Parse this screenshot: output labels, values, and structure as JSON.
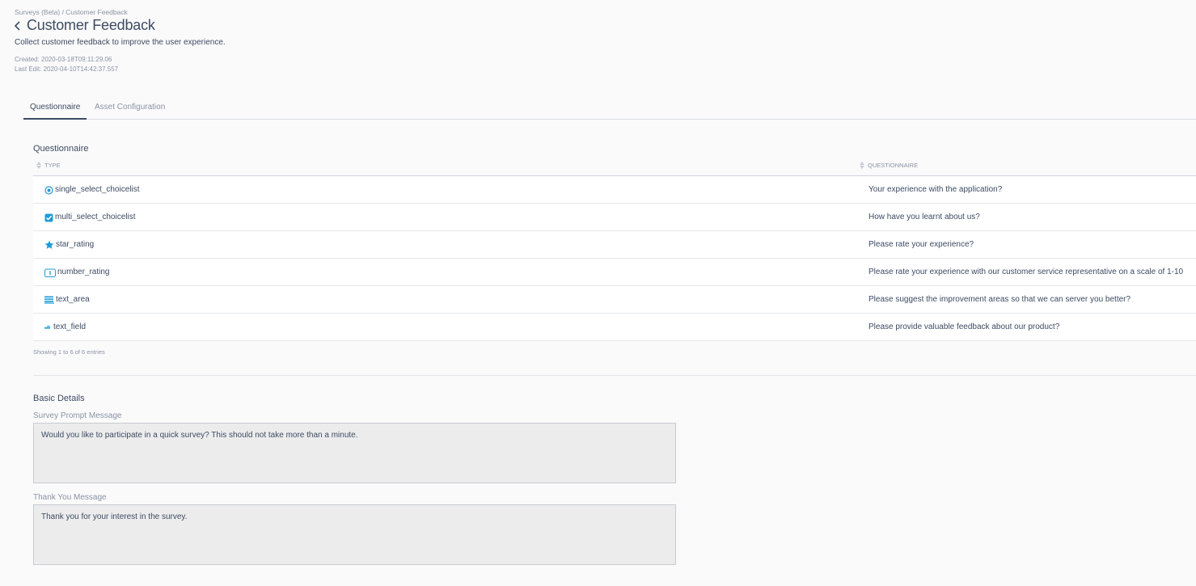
{
  "breadcrumb": "Surveys (Beta) / Customer Feedback",
  "header": {
    "title": "Customer Feedback",
    "description": "Collect customer feedback to improve the user experience.",
    "created": "Created: 2020-03-18T09:11:29.06",
    "last_edit": "Last Edit: 2020-04-10T14:42:37.557"
  },
  "tabs": [
    {
      "label": "Questionnaire",
      "active": true
    },
    {
      "label": "Asset Configuration",
      "active": false
    }
  ],
  "questionnaire": {
    "title": "Questionnaire",
    "columns": [
      "TYPE",
      "QUESTIONNAIRE"
    ],
    "rows": [
      {
        "type": "single_select_choicelist",
        "icon": "radio-icon",
        "question": "Your experience with the application?"
      },
      {
        "type": "multi_select_choicelist",
        "icon": "checkbox-icon",
        "question": "How have you learnt about us?"
      },
      {
        "type": "star_rating",
        "icon": "star-icon",
        "question": "Please rate your experience?"
      },
      {
        "type": "number_rating",
        "icon": "number-icon",
        "question": "Please rate your experience with our customer service representative on a scale of 1-10"
      },
      {
        "type": "text_area",
        "icon": "text-area-icon",
        "question": "Please suggest the improvement areas so that we can server you better?"
      },
      {
        "type": "text_field",
        "icon": "text-field-icon",
        "question": "Please provide valuable feedback about our product?"
      }
    ],
    "entries_text": "Showing 1 to 6 of 6 entries"
  },
  "basic_details": {
    "title": "Basic Details",
    "prompt_label": "Survey Prompt Message",
    "prompt_value": "Would you like to participate in a quick survey? This should not take more than a minute.",
    "thanks_label": "Thank You Message",
    "thanks_value": "Thank you for your interest in the survey."
  },
  "colors": {
    "text": "#3d4b63",
    "muted": "#8a93a6",
    "accent": "#1e9bd7"
  }
}
